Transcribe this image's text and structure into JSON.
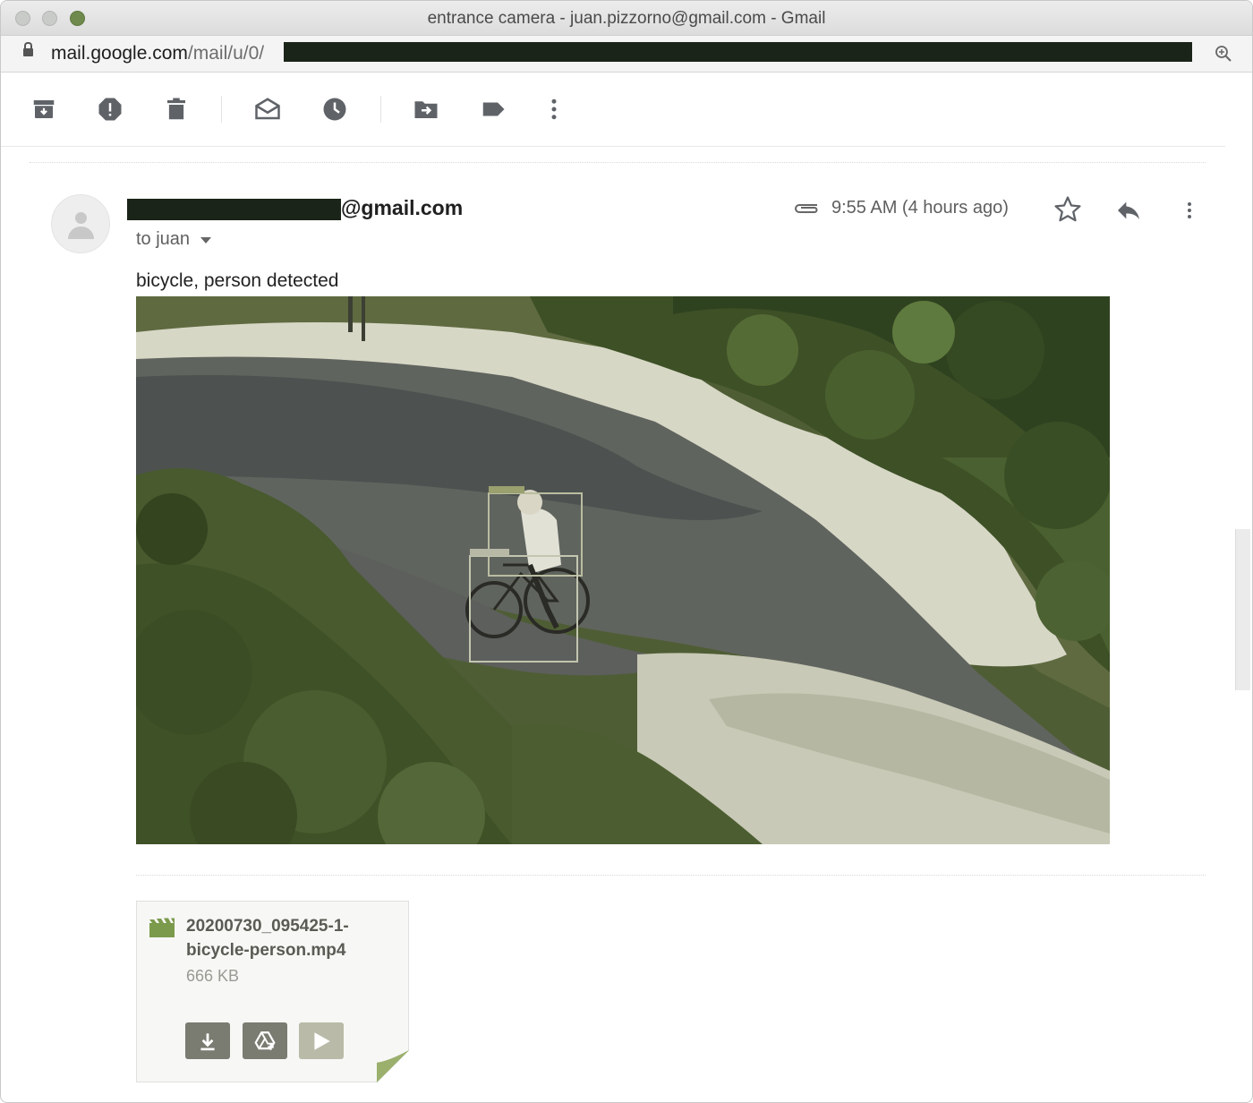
{
  "window": {
    "title": "entrance camera - juan.pizzorno@gmail.com - Gmail",
    "traffic_lights": [
      "close-button",
      "minimize-button",
      "zoom-button"
    ]
  },
  "urlbar": {
    "url_host": "mail.google.com",
    "url_path": "/mail/u/0/",
    "icons": [
      "lock-icon",
      "zoom-icon"
    ]
  },
  "toolbar": {
    "icons": [
      "archive-icon",
      "report-spam-icon",
      "delete-icon",
      "mark-unread-icon",
      "snooze-icon",
      "move-to-icon",
      "label-icon",
      "more-vert-icon"
    ]
  },
  "message": {
    "sender_email": "@gmail.com",
    "to_label": "to juan",
    "timestamp": "9:55 AM (4 hours ago)",
    "body": "bicycle, person detected",
    "icons": [
      "avatar-icon",
      "attachment-clip-icon",
      "star-icon",
      "reply-icon",
      "more-vert-icon"
    ]
  },
  "attachment": {
    "filename_line1": "20200730_095425-1-",
    "filename_line2": "bicycle-person.mp4",
    "size": "666 KB",
    "icons": [
      "video-file-icon",
      "download-icon",
      "save-to-drive-icon",
      "play-icon"
    ],
    "colors": {
      "accent": "#7b9a4c",
      "button": "#7a7c72"
    }
  }
}
